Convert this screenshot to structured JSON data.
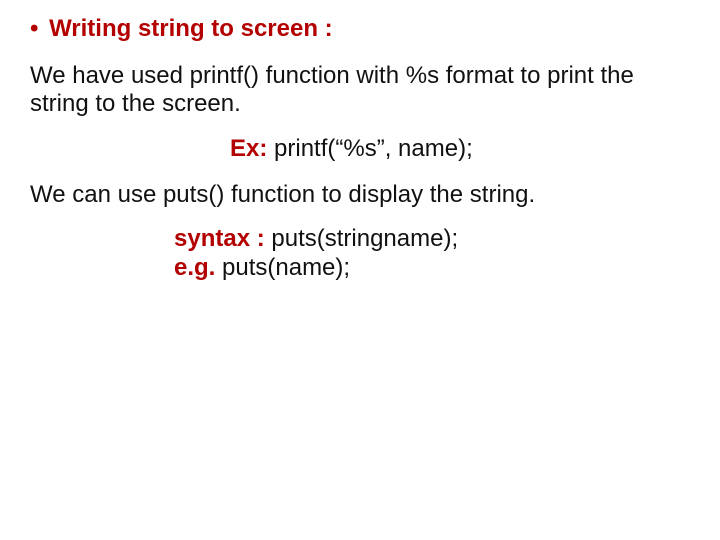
{
  "heading": {
    "bullet": "•",
    "text": "Writing string to screen :"
  },
  "para1": "We have used printf() function with %s format to print the string to the screen.",
  "example": {
    "label": "Ex:",
    "code": "printf(“%s”, name);"
  },
  "para2": "We can use puts() function to display the string.",
  "syntax": {
    "label": "syntax :",
    "code": "puts(stringname);",
    "eg_label": "e.g.",
    "eg_code": "puts(name);"
  }
}
